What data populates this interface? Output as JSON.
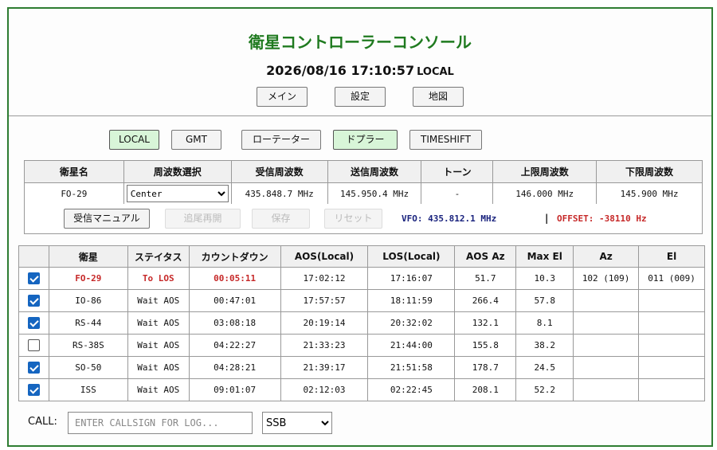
{
  "app": {
    "title": "衛星コントローラーコンソール",
    "datetime": "2026/08/16 17:10:57",
    "timezone": "LOCAL"
  },
  "nav": {
    "main": "メイン",
    "settings": "設定",
    "map": "地図"
  },
  "modes": {
    "local": "LOCAL",
    "gmt": "GMT",
    "rotator": "ローテーター",
    "doppler": "ドプラー",
    "timeshift": "TIMESHIFT"
  },
  "freq_table": {
    "headers": {
      "name": "衛星名",
      "select": "周波数選択",
      "rx": "受信周波数",
      "tx": "送信周波数",
      "tone": "トーン",
      "upper": "上限周波数",
      "lower": "下限周波数"
    },
    "row": {
      "name": "FO-29",
      "select": "Center",
      "rx": "435.848.7 MHz",
      "tx": "145.950.4 MHz",
      "tone": "-",
      "upper": "146.000 MHz",
      "lower": "145.900 MHz"
    }
  },
  "controls": {
    "manual": "受信マニュアル",
    "retrack": "追尾再開",
    "save": "保存",
    "reset": "リセット",
    "vfo": "VFO: 435.812.1 MHz",
    "separator": "|",
    "offset": "OFFSET: -38110 Hz"
  },
  "sat_table": {
    "headers": {
      "satellite": "衛星",
      "status": "ステイタス",
      "countdown": "カウントダウン",
      "aos": "AOS(Local)",
      "los": "LOS(Local)",
      "aos_az": "AOS Az",
      "max_el": "Max El",
      "az": "Az",
      "el": "El"
    },
    "rows": [
      {
        "checked": true,
        "name": "FO-29",
        "status": "To LOS",
        "countdown": "00:05:11",
        "aos": "17:02:12",
        "los": "17:16:07",
        "aos_az": "51.7",
        "max_el": "10.3",
        "az": "102 (109)",
        "el": "011 (009)"
      },
      {
        "checked": true,
        "name": "IO-86",
        "status": "Wait AOS",
        "countdown": "00:47:01",
        "aos": "17:57:57",
        "los": "18:11:59",
        "aos_az": "266.4",
        "max_el": "57.8",
        "az": "",
        "el": ""
      },
      {
        "checked": true,
        "name": "RS-44",
        "status": "Wait AOS",
        "countdown": "03:08:18",
        "aos": "20:19:14",
        "los": "20:32:02",
        "aos_az": "132.1",
        "max_el": "8.1",
        "az": "",
        "el": ""
      },
      {
        "checked": false,
        "name": "RS-38S",
        "status": "Wait AOS",
        "countdown": "04:22:27",
        "aos": "21:33:23",
        "los": "21:44:00",
        "aos_az": "155.8",
        "max_el": "38.2",
        "az": "",
        "el": ""
      },
      {
        "checked": true,
        "name": "SO-50",
        "status": "Wait AOS",
        "countdown": "04:28:21",
        "aos": "21:39:17",
        "los": "21:51:58",
        "aos_az": "178.7",
        "max_el": "24.5",
        "az": "",
        "el": ""
      },
      {
        "checked": true,
        "name": "ISS",
        "status": "Wait AOS",
        "countdown": "09:01:07",
        "aos": "02:12:03",
        "los": "02:22:45",
        "aos_az": "208.1",
        "max_el": "52.2",
        "az": "",
        "el": ""
      }
    ]
  },
  "log": {
    "label": "CALL:",
    "placeholder": "ENTER CALLSIGN FOR LOG...",
    "mode": "SSB"
  },
  "colors": {
    "title_green": "#1f7a1f",
    "active_mode": "#d8f5d8",
    "vfo_blue": "#1a237e",
    "alert_red": "#c62828",
    "checkbox_blue": "#1565c0"
  }
}
